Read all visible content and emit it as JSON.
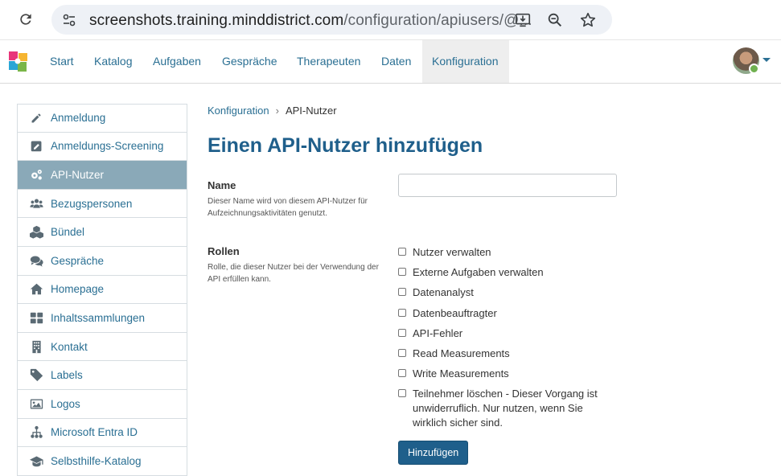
{
  "browser": {
    "url_host": "screenshots.training.minddistrict.com",
    "url_path": "/configuration/apiusers/@..."
  },
  "nav": {
    "items": [
      "Start",
      "Katalog",
      "Aufgaben",
      "Gespräche",
      "Therapeuten",
      "Daten",
      "Konfiguration"
    ],
    "active": "Konfiguration"
  },
  "sidebar": {
    "items": [
      {
        "label": "Anmeldung",
        "icon": "pencil-icon"
      },
      {
        "label": "Anmeldungs-Screening",
        "icon": "edit-square-icon"
      },
      {
        "label": "API-Nutzer",
        "icon": "gears-icon"
      },
      {
        "label": "Bezugspersonen",
        "icon": "users-icon"
      },
      {
        "label": "Bündel",
        "icon": "cubes-icon"
      },
      {
        "label": "Gespräche",
        "icon": "comments-icon"
      },
      {
        "label": "Homepage",
        "icon": "home-icon"
      },
      {
        "label": "Inhaltssammlungen",
        "icon": "grid-icon"
      },
      {
        "label": "Kontakt",
        "icon": "building-icon"
      },
      {
        "label": "Labels",
        "icon": "tag-icon"
      },
      {
        "label": "Logos",
        "icon": "image-icon"
      },
      {
        "label": "Microsoft Entra ID",
        "icon": "sitemap-icon"
      },
      {
        "label": "Selbsthilfe-Katalog",
        "icon": "graduation-cap-icon"
      }
    ],
    "active": "API-Nutzer"
  },
  "breadcrumb": {
    "parent": "Konfiguration",
    "current": "API-Nutzer"
  },
  "page": {
    "title": "Einen API-Nutzer hinzufügen"
  },
  "form": {
    "name": {
      "label": "Name",
      "help": "Dieser Name wird von diesem API-Nutzer für Aufzeichnungsaktivitäten genutzt.",
      "value": ""
    },
    "roles": {
      "label": "Rollen",
      "help": "Rolle, die dieser Nutzer bei der Verwendung der API erfüllen kann.",
      "options": [
        {
          "label": "Nutzer verwalten",
          "checked": false
        },
        {
          "label": "Externe Aufgaben verwalten",
          "checked": false
        },
        {
          "label": "Datenanalyst",
          "checked": false
        },
        {
          "label": "Datenbeauftragter",
          "checked": false
        },
        {
          "label": "API-Fehler",
          "checked": false
        },
        {
          "label": "Read Measurements",
          "checked": false
        },
        {
          "label": "Write Measurements",
          "checked": false
        },
        {
          "label": "Teilnehmer löschen - Dieser Vorgang ist unwiderruflich. Nur nutzen, wenn Sie wirklich sicher sind.",
          "checked": false
        }
      ]
    },
    "submit_label": "Hinzufügen"
  },
  "colors": {
    "primary": "#1f5f8b",
    "link": "#2a6f93",
    "sidebar_active": "#8aa9b8"
  }
}
